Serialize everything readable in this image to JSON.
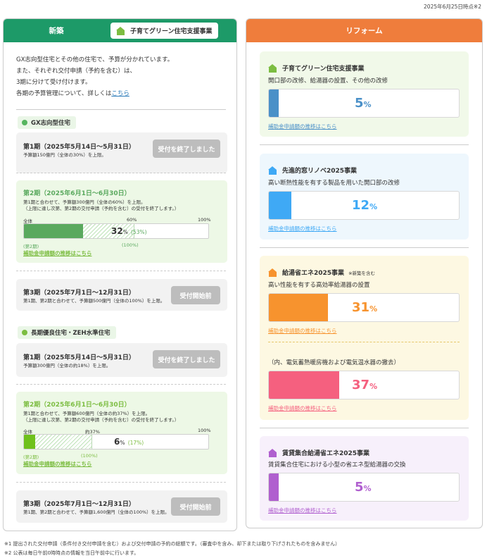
{
  "as_of": "2025年6月25日時点※2",
  "left": {
    "title": "新築",
    "tag": "子育てグリーン住宅支援事業",
    "intro": {
      "line1": "GX志向型住宅とその他の住宅で、予算が分かれています。",
      "line2": "また、それぞれ交付申請（予約を含む）は、",
      "line3": "3期に分けて受け付けます。",
      "line4_prefix": "各期の予算管理について、詳しくは",
      "line4_link": "こちら"
    },
    "gx": {
      "heading": "GX志向型住宅",
      "p1": {
        "title": "第1期（2025年5月14日～5月31日）",
        "sub": "予算額150億円（全体の30%）を上限。",
        "button": "受付を終了しました"
      },
      "p2": {
        "title": "第2期（2025年6月1日～6月30日）",
        "sub1": "第1期と合わせて、予算額300億円（全体の60%）を上限。",
        "sub2": "（上限に達し次第、第2期の交付申請（予約を含む）の受付を終了します。）",
        "label_total": "全体",
        "label_mid": "60%",
        "label_end": "100%",
        "percent_main": "32",
        "percent_unit": "%",
        "percent_sub": "(53%)",
        "note_left": "(第2期)",
        "note_right": "(100%)",
        "link": "補助金申請額の推移はこちら",
        "fill_fraction": 0.32,
        "period_fraction": 0.6
      },
      "p3": {
        "title": "第3期（2025年7月1日～12月31日）",
        "sub": "第1期、第2期と合わせて、予算額500億円（全体の100%）を上限。",
        "button": "受付開始前"
      }
    },
    "long": {
      "heading": "長期優良住宅・ZEH水準住宅",
      "p1": {
        "title": "第1期（2025年5月14日～5月31日）",
        "sub": "予算額300億円（全体の約18%）を上限。",
        "button": "受付を終了しました"
      },
      "p2": {
        "title": "第2期（2025年6月1日～6月30日）",
        "sub1": "第1期と合わせて、予算額600億円（全体の約37%）を上限。",
        "sub2": "（上限に達し次第、第2期の交付申請（予約を含む）の受付を終了します。）",
        "label_total": "全体",
        "label_mid": "約37%",
        "label_end": "100%",
        "percent_main": "6",
        "percent_unit": "%",
        "percent_sub": "(17%)",
        "note_left": "(第2期)",
        "note_right": "(100%)",
        "link": "補助金申請額の推移はこちら",
        "fill_fraction": 0.06,
        "period_fraction": 0.37
      },
      "p3": {
        "title": "第3期（2025年7月1日～12月31日）",
        "sub": "第1期、第2期と合わせて、予算額1,600億円（全体の100%）を上限。",
        "button": "受付開始前"
      }
    }
  },
  "right": {
    "title": "リフォーム",
    "cards": {
      "kosodate": {
        "title": "子育てグリーン住宅支援事業",
        "desc": "開口部の改修、給湯器の設置、その他の改修",
        "percent": "5",
        "unit": "%",
        "link": "補助金申請額の推移はこちら",
        "color": "#4a90c8",
        "fill_fraction": 0.05
      },
      "mado": {
        "title": "先進的窓リノベ2025事業",
        "desc": "高い断熱性能を有する製品を用いた開口部の改修",
        "percent": "12",
        "unit": "%",
        "link": "補助金申請額の推移はこちら",
        "color": "#3fa9f5",
        "fill_fraction": 0.12
      },
      "kyuto": {
        "title": "給湯省エネ2025事業",
        "note": "※新築を含む",
        "desc": "高い性能を有する高効率給湯器の設置",
        "percent": "31",
        "unit": "%",
        "link": "補助金申請額の推移はこちら",
        "color": "#f7932e",
        "fill_fraction": 0.31,
        "sub_desc": "（内、電気蓄熱暖房機および電気温水器の撤去）",
        "sub_percent": "37",
        "sub_unit": "%",
        "sub_link": "補助金申請額の推移はこちら",
        "sub_color": "#f5607f",
        "sub_fill_fraction": 0.37
      },
      "chintai": {
        "title": "賃貸集合給湯省エネ2025事業",
        "desc": "賃貸集合住宅における小型の省エネ型給湯器の交換",
        "percent": "5",
        "unit": "%",
        "link": "補助金申請額の推移はこちら",
        "color": "#b05fcf",
        "fill_fraction": 0.05
      }
    }
  },
  "footnotes": {
    "n1": "※1  提出された交付申請（条件付き交付申請を含む）および交付申請の予約の総額です。（審査中を含み、却下または取り下げされたものを含みません）",
    "n2": "※2  公表は毎日午前0時時点の情報を当日午前中に行います。"
  }
}
